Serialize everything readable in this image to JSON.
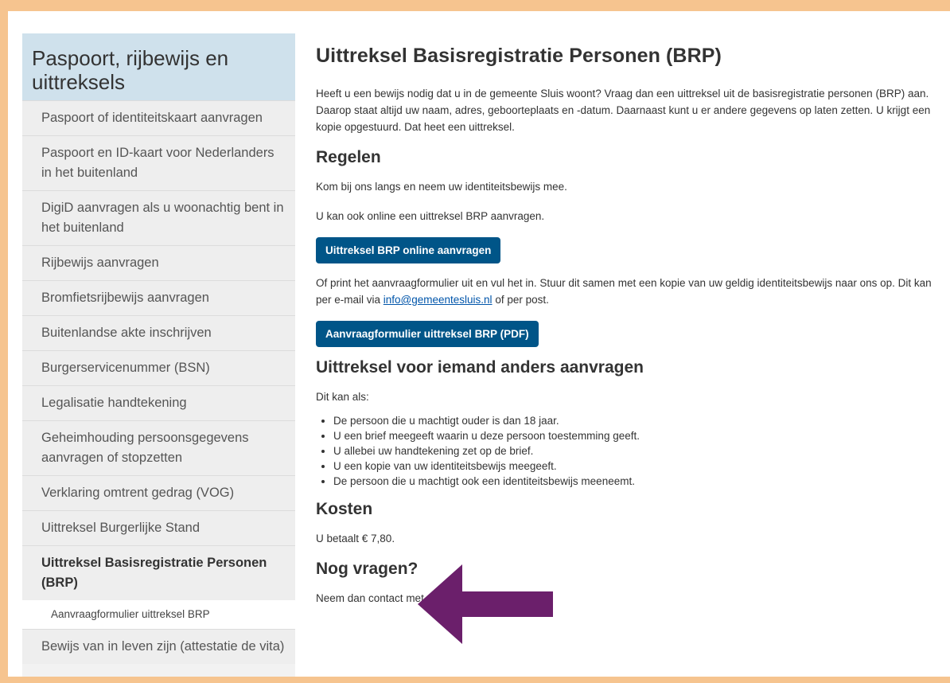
{
  "sidebar": {
    "title": "Paspoort, rijbewijs en uittreksels",
    "items": [
      {
        "label": "Paspoort of identiteitskaart aanvragen"
      },
      {
        "label": "Paspoort en ID-kaart voor Nederlanders in het buitenland"
      },
      {
        "label": "DigiD aanvragen als u woonachtig bent in het buitenland"
      },
      {
        "label": "Rijbewijs aanvragen"
      },
      {
        "label": "Bromfietsrijbewijs aanvragen"
      },
      {
        "label": "Buitenlandse akte inschrijven"
      },
      {
        "label": "Burgerservicenummer (BSN)"
      },
      {
        "label": "Legalisatie handtekening"
      },
      {
        "label": "Geheimhouding persoonsgegevens aanvragen of stopzetten"
      },
      {
        "label": "Verklaring omtrent gedrag (VOG)"
      },
      {
        "label": "Uittreksel Burgerlijke Stand"
      },
      {
        "label": "Uittreksel Basisregistratie Personen (BRP)"
      },
      {
        "label": "Bewijs van in leven zijn (attestatie de vita)"
      }
    ],
    "subitem": "Aanvraagformulier uittreksel BRP"
  },
  "main": {
    "title": "Uittreksel Basisregistratie Personen (BRP)",
    "intro": "Heeft u een bewijs nodig dat u in de gemeente Sluis woont? Vraag dan een uittreksel uit de basisregistratie personen (BRP) aan. Daarop staat altijd uw naam, adres, geboorteplaats en -datum. Daarnaast kunt u er andere gegevens op laten zetten. U krijgt een kopie opgestuurd. Dat heet een uittreksel.",
    "regelen_heading": "Regelen",
    "regelen_p1": "Kom bij ons langs en neem uw identiteitsbewijs mee.",
    "regelen_p2": "U kan ook online een uittreksel BRP aanvragen.",
    "online_button": "Uittreksel BRP online aanvragen",
    "print_p_before": "Of print het aanvraagformulier uit en vul het in. Stuur dit samen met een kopie van uw geldig identiteitsbewijs naar ons op. Dit kan per e-mail via ",
    "email": "info@gemeentesluis.nl",
    "print_p_after": " of per post.",
    "pdf_button": "Aanvraagformulier uittreksel BRP (PDF)",
    "anders_heading": "Uittreksel voor iemand anders aanvragen",
    "anders_intro": "Dit kan als:",
    "anders_list": [
      "De persoon die u machtigt ouder is dan 18 jaar.",
      "U een brief meegeeft waarin u deze persoon toestemming geeft.",
      "U allebei uw handtekening zet op de brief.",
      "U een kopie van uw identiteitsbewijs meegeeft.",
      "De persoon die u machtigt ook een identiteitsbewijs meeneemt."
    ],
    "kosten_heading": "Kosten",
    "kosten_text": "U betaalt € 7,80.",
    "vragen_heading": "Nog vragen?",
    "vragen_text": "Neem dan contact met ons op via 14 0117."
  },
  "colors": {
    "border": "#f6c48f",
    "sidebar_title_bg": "#cfe1ec",
    "button_bg": "#005588",
    "arrow": "#6b1f6b"
  }
}
